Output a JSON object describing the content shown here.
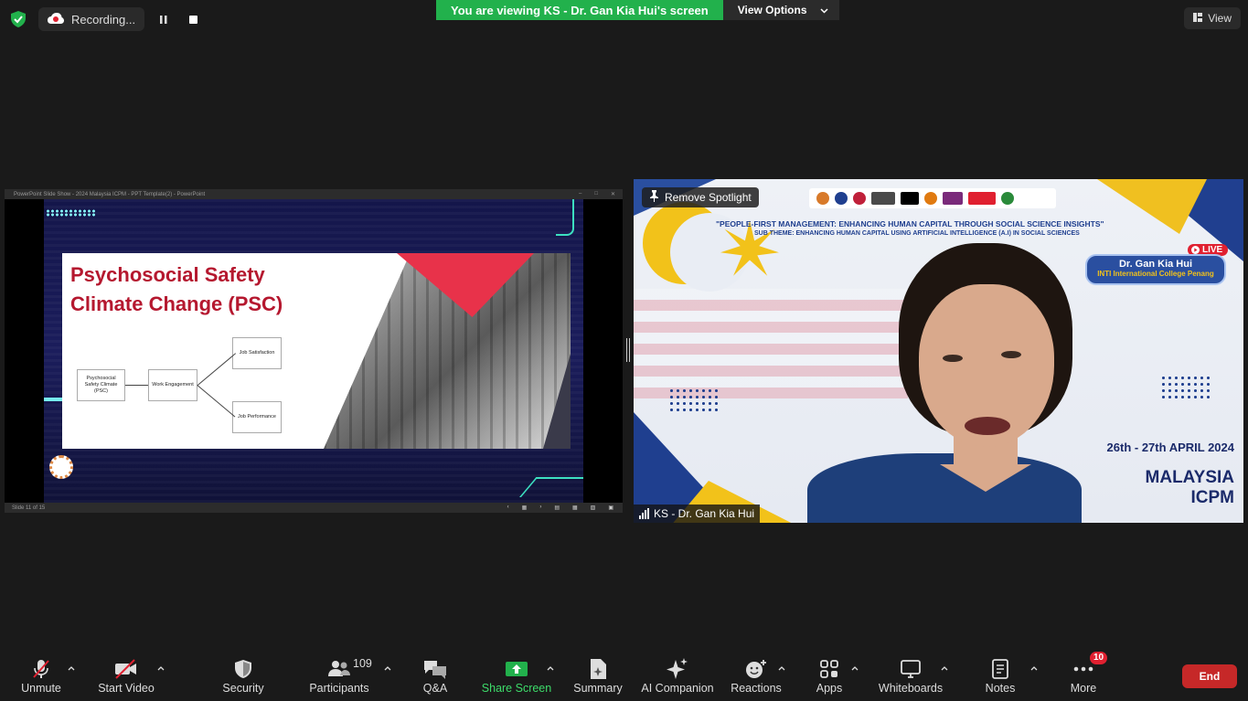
{
  "top": {
    "recording_label": "Recording...",
    "banner_text": "You are viewing KS - Dr. Gan Kia Hui's screen",
    "view_options_label": "View Options",
    "view_label": "View"
  },
  "share": {
    "window_title": "PowerPoint Slide Show - 2024 Malaysia ICPM - PPT Template(2) - PowerPoint",
    "slide_title": "Psychosocial Safety\nClimate Change (PSC)",
    "diagram": {
      "psc": "Psychosocial Safety Climate (PSC)",
      "engagement": "Work Engagement",
      "satisfaction": "Job Satisfaction",
      "performance": "Job Performance"
    },
    "status_text": "Slide 11 of 15"
  },
  "video": {
    "theme_line": "\"PEOPLE-FIRST MANAGEMENT: ENHANCING HUMAN CAPITAL THROUGH SOCIAL SCIENCE INSIGHTS\"",
    "subtheme_line": "SUB THEME:  ENHANCING HUMAN CAPITAL USING ARTIFICIAL INTELLIGENCE (A.I) IN SOCIAL SCIENCES",
    "live_label": "LIVE",
    "card_name": "Dr. Gan Kia Hui",
    "card_org": "INTI International College Penang",
    "date_text": "26th - 27th APRIL 2024",
    "conf_text": "MALAYSIA\nICPM",
    "spotlight_label": "Remove Spotlight",
    "participant_name": "KS - Dr. Gan Kia Hui"
  },
  "toolbar": {
    "unmute": "Unmute",
    "start_video": "Start Video",
    "security": "Security",
    "participants": "Participants",
    "participants_count": "109",
    "qa": "Q&A",
    "share_screen": "Share Screen",
    "summary": "Summary",
    "ai_companion": "AI Companion",
    "reactions": "Reactions",
    "apps": "Apps",
    "whiteboards": "Whiteboards",
    "notes": "Notes",
    "more": "More",
    "more_badge": "10",
    "end": "End"
  },
  "colors": {
    "accent_green": "#22b14c",
    "end_red": "#c62828",
    "slide_title_red": "#b5182f"
  }
}
